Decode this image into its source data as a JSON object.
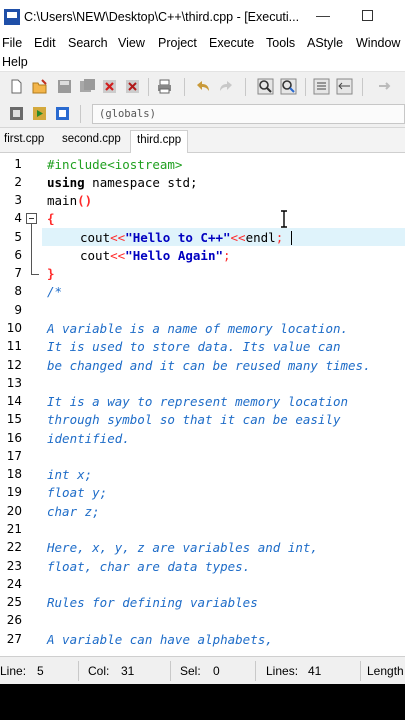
{
  "window": {
    "title": "C:\\Users\\NEW\\Desktop\\C++\\third.cpp - [Executi..."
  },
  "menu": {
    "items": [
      "File",
      "Edit",
      "Search",
      "View",
      "Project",
      "Execute",
      "Tools",
      "AStyle",
      "Window"
    ],
    "second_row": [
      "Help"
    ]
  },
  "toolbar": {
    "scope_label": "(globals)"
  },
  "tabs": [
    {
      "label": "first.cpp",
      "active": false
    },
    {
      "label": "second.cpp",
      "active": false
    },
    {
      "label": "third.cpp",
      "active": true
    }
  ],
  "editor": {
    "line_numbers": [
      "1",
      "2",
      "3",
      "4",
      "5",
      "6",
      "7",
      "8",
      "9",
      "10",
      "11",
      "12",
      "13",
      "14",
      "15",
      "16",
      "17",
      "18",
      "19",
      "20",
      "21",
      "22",
      "23",
      "24",
      "25",
      "26",
      "27"
    ],
    "lines": [
      {
        "text": "#include<iostream>"
      },
      {
        "text": "using namespace std;"
      },
      {
        "text": "main()"
      },
      {
        "text": "{"
      },
      {
        "text": "    cout<<\"Hello to C++\"<<endl;"
      },
      {
        "text": "    cout<<\"Hello Again\";"
      },
      {
        "text": "}"
      },
      {
        "text": "/*"
      },
      {
        "text": ""
      },
      {
        "text": "A variable is a name of memory location."
      },
      {
        "text": "It is used to store data. Its value can"
      },
      {
        "text": "be changed and it can be reused many times."
      },
      {
        "text": ""
      },
      {
        "text": "It is a way to represent memory location"
      },
      {
        "text": "through symbol so that it can be easily"
      },
      {
        "text": "identified."
      },
      {
        "text": ""
      },
      {
        "text": "int x;"
      },
      {
        "text": "float y;"
      },
      {
        "text": "char z;"
      },
      {
        "text": ""
      },
      {
        "text": "Here, x, y, z are variables and int,"
      },
      {
        "text": "float, char are data types."
      },
      {
        "text": ""
      },
      {
        "text": "Rules for defining variables"
      },
      {
        "text": ""
      },
      {
        "text": "A variable can have alphabets,"
      }
    ],
    "tokens": {
      "include": "#include<iostream>",
      "using": "using",
      "namespace_std": " namespace std;",
      "main": "main",
      "paren": "()",
      "open_brace": "{",
      "close_brace": "}",
      "cout": "cout",
      "op": "<<",
      "str1": "\"Hello to C++\"",
      "endl": "endl",
      "semi": ";",
      "str2": "\"Hello Again\"",
      "comment_open": "/*"
    }
  },
  "status": {
    "line_label": "Line:",
    "line_value": "5",
    "col_label": "Col:",
    "col_value": "31",
    "sel_label": "Sel:",
    "sel_value": "0",
    "lines_label": "Lines:",
    "lines_value": "41",
    "length_label": "Length"
  },
  "colors": {
    "preprocessor": "#20a020",
    "string": "#0000c0",
    "symbol": "#ff2a2a",
    "comment": "#1e6cc8",
    "current_line": "#dff3fb"
  }
}
